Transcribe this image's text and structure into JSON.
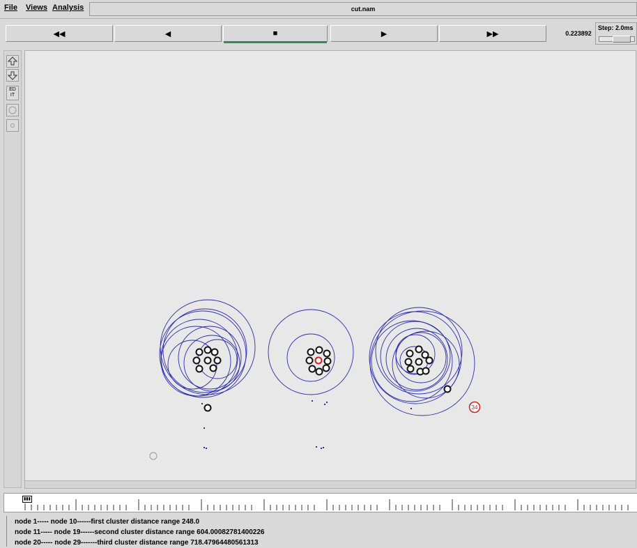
{
  "menu": {
    "file": "File",
    "views": "Views",
    "analysis": "Analysis"
  },
  "window_title": "cut.nam",
  "playback": {
    "rewind_fast": "◀◀",
    "rewind": "◀",
    "stop": "■",
    "play": "▶",
    "forward_fast": "▶▶",
    "time": "0.223892",
    "step_label": "Step: 2.0ms"
  },
  "tools": [
    "zoom-in-icon",
    "zoom-out-icon",
    "edit-button",
    "circle-icon",
    "small-circle-icon"
  ],
  "edit_label": "ED IT",
  "nodes": {
    "red_highlight_label": "34"
  },
  "annotations": [
    "node 1----- node 10------first cluster distance range 248.0",
    "node 11----- node 19------second cluster distance range 604.00082781400226",
    "node 20----- node 29-------third cluster distance range 718.47964480561313"
  ],
  "colors": {
    "range_circle": "#2b2bb8",
    "node": "#111111",
    "highlight": "#cc2222",
    "active_play": "#2e8b57"
  }
}
